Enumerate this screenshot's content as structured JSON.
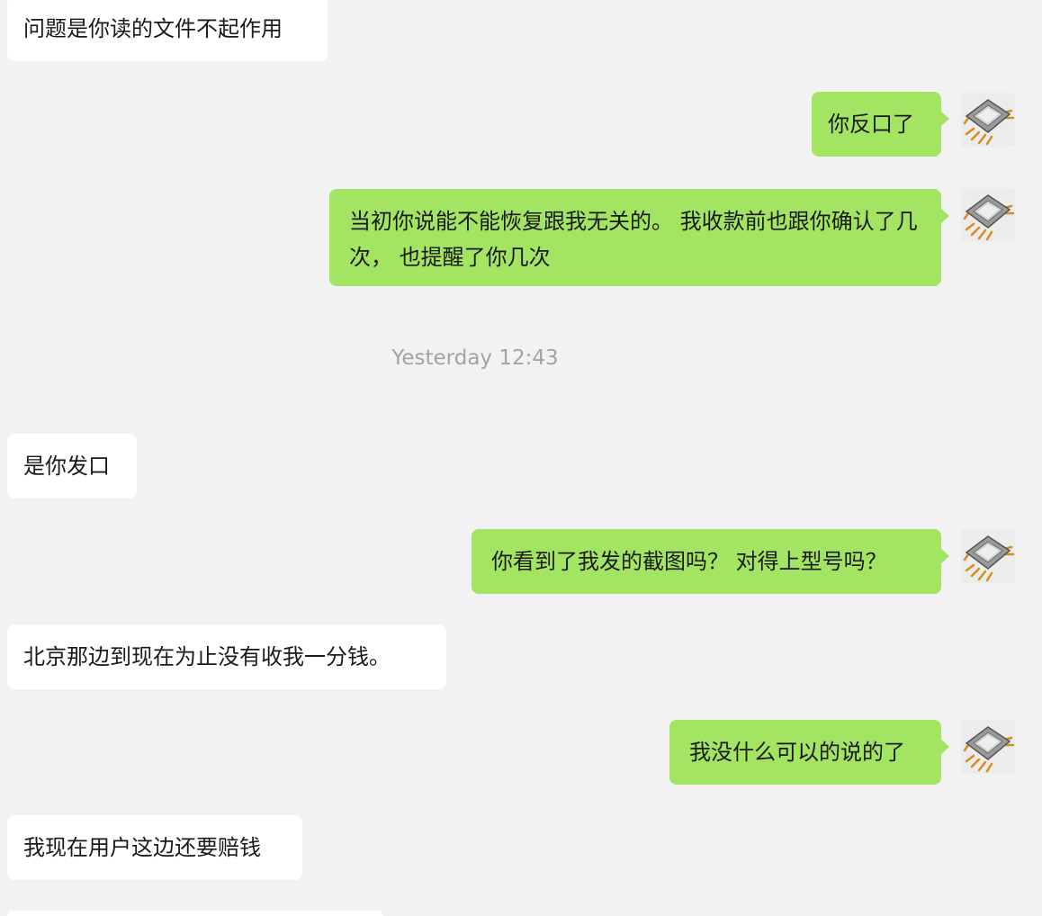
{
  "messages": [
    {
      "side": "incoming",
      "text": "问题是你读的文件不起作用"
    },
    {
      "side": "outgoing",
      "text": "你反口了",
      "avatar": "microchip-icon"
    },
    {
      "side": "outgoing",
      "text": "当初你说能不能恢复跟我无关的。 我收款前也跟你确认了几次， 也提醒了你几次",
      "avatar": "microchip-icon"
    },
    {
      "side": "incoming",
      "text": "是你发口"
    },
    {
      "side": "outgoing",
      "text": "你看到了我发的截图吗？ 对得上型号吗？",
      "avatar": "microchip-icon"
    },
    {
      "side": "incoming",
      "text": "北京那边到现在为止没有收我一分钱。"
    },
    {
      "side": "outgoing",
      "text": "我没什么可以的说的了",
      "avatar": "microchip-icon"
    },
    {
      "side": "incoming",
      "text": "我现在用户这边还要赔钱"
    }
  ],
  "timestamp": "Yesterday 12:43",
  "colors": {
    "background": "#f2f2f2",
    "incoming_bubble": "#ffffff",
    "outgoing_bubble": "#a4e463",
    "timestamp_text": "#a3a3a3"
  }
}
